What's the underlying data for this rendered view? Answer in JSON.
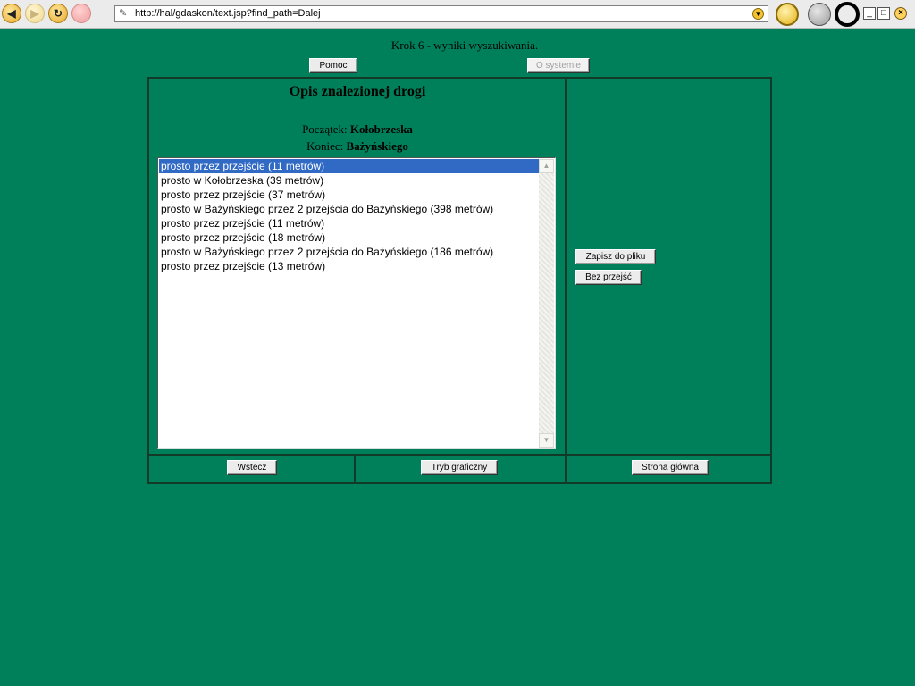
{
  "browser": {
    "url": "http://hal/gdaskon/text.jsp?find_path=Dalej",
    "icons": {
      "back": "back-arrow-icon",
      "forward": "forward-arrow-icon",
      "reload": "reload-icon",
      "stop": "stop-icon",
      "url": "link-icon",
      "go": "dropdown-icon",
      "search": "search-icon",
      "manager": "manager-icon",
      "ring": "ring-icon"
    }
  },
  "page": {
    "step_title": "Krok 6 - wyniki wyszukiwania.",
    "help_button": "Pomoc",
    "about_button": "O systemie",
    "description_title": "Opis znalezionej drogi",
    "start_label": "Początek:",
    "start_value": "Kołobrzeska",
    "end_label": "Koniec:",
    "end_value": "Bażyńskiego",
    "route_steps": [
      "prosto przez przejście (11 metrów)",
      "prosto w Kołobrzeska (39 metrów)",
      "prosto przez przejście (37 metrów)",
      "prosto w Bażyńskiego przez 2 przejścia do Bażyńskiego (398 metrów)",
      "prosto przez przejście (11 metrów)",
      "prosto przez przejście (18 metrów)",
      "prosto w Bażyńskiego przez 2 przejścia do Bażyńskiego (186 metrów)",
      "prosto przez przejście (13 metrów)"
    ],
    "selected_step_index": 0,
    "save_button": "Zapisz do pliku",
    "no_crossings_button": "Bez przejść",
    "back_button": "Wstecz",
    "graphic_mode_button": "Tryb graficzny",
    "home_button": "Strona główna"
  },
  "colors": {
    "page_background": "#00805a",
    "frame_border": "#113a28",
    "selection": "#316ac5"
  }
}
